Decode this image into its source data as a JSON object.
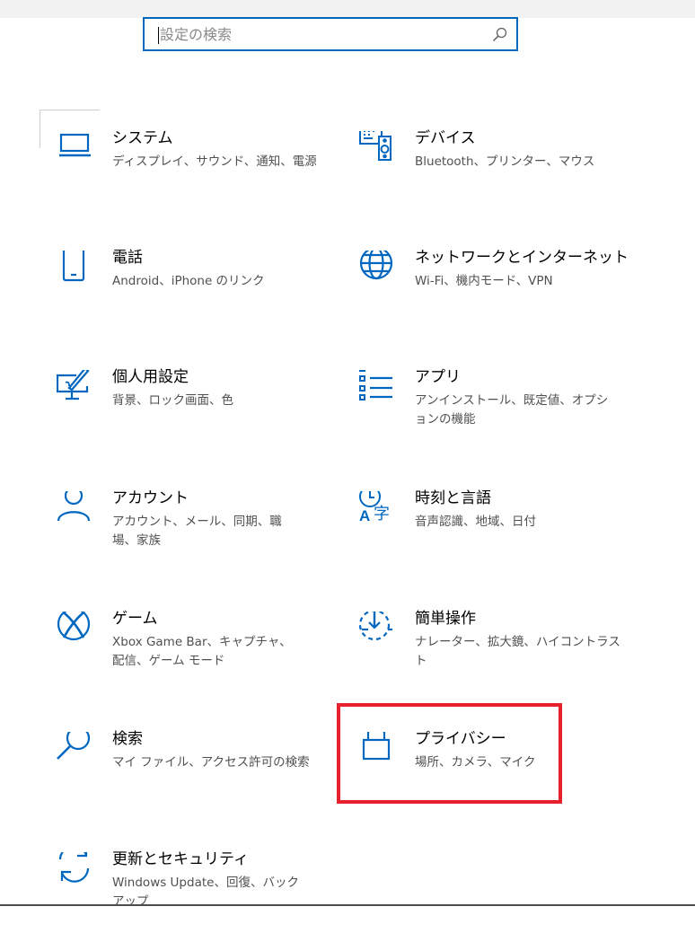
{
  "search": {
    "placeholder": "設定の検索",
    "value": ""
  },
  "accent_color": "#0067c0",
  "highlight_color": "#e81f2d",
  "tiles": [
    {
      "id": "system",
      "icon": "laptop-icon",
      "title": "システム",
      "desc": "ディスプレイ、サウンド、通知、電源"
    },
    {
      "id": "devices",
      "icon": "keyboard-speaker-icon",
      "title": "デバイス",
      "desc": "Bluetooth、プリンター、マウス"
    },
    {
      "id": "phone",
      "icon": "phone-icon",
      "title": "電話",
      "desc": "Android、iPhone のリンク"
    },
    {
      "id": "network",
      "icon": "globe-icon",
      "title": "ネットワークとインターネット",
      "desc": "Wi-Fi、機内モード、VPN"
    },
    {
      "id": "personalization",
      "icon": "monitor-pen-icon",
      "title": "個人用設定",
      "desc": "背景、ロック画面、色"
    },
    {
      "id": "apps",
      "icon": "app-list-icon",
      "title": "アプリ",
      "desc": "アンインストール、既定値、オプションの機能"
    },
    {
      "id": "accounts",
      "icon": "person-icon",
      "title": "アカウント",
      "desc": "アカウント、メール、同期、職場、家族"
    },
    {
      "id": "time-language",
      "icon": "clock-language-icon",
      "title": "時刻と言語",
      "desc": "音声認識、地域、日付"
    },
    {
      "id": "gaming",
      "icon": "xbox-icon",
      "title": "ゲーム",
      "desc": "Xbox Game Bar、キャプチャ、配信、ゲーム モード"
    },
    {
      "id": "ease-of-access",
      "icon": "ease-of-access-icon",
      "title": "簡単操作",
      "desc": "ナレーター、拡大鏡、ハイコントラスト"
    },
    {
      "id": "search",
      "icon": "magnifier-icon",
      "title": "検索",
      "desc": "マイ ファイル、アクセス許可の検索"
    },
    {
      "id": "privacy",
      "icon": "lock-icon",
      "title": "プライバシー",
      "desc": "場所、カメラ、マイク"
    },
    {
      "id": "update-security",
      "icon": "sync-arrows-icon",
      "title": "更新とセキュリティ",
      "desc": "Windows Update、回復、バックアップ"
    }
  ]
}
